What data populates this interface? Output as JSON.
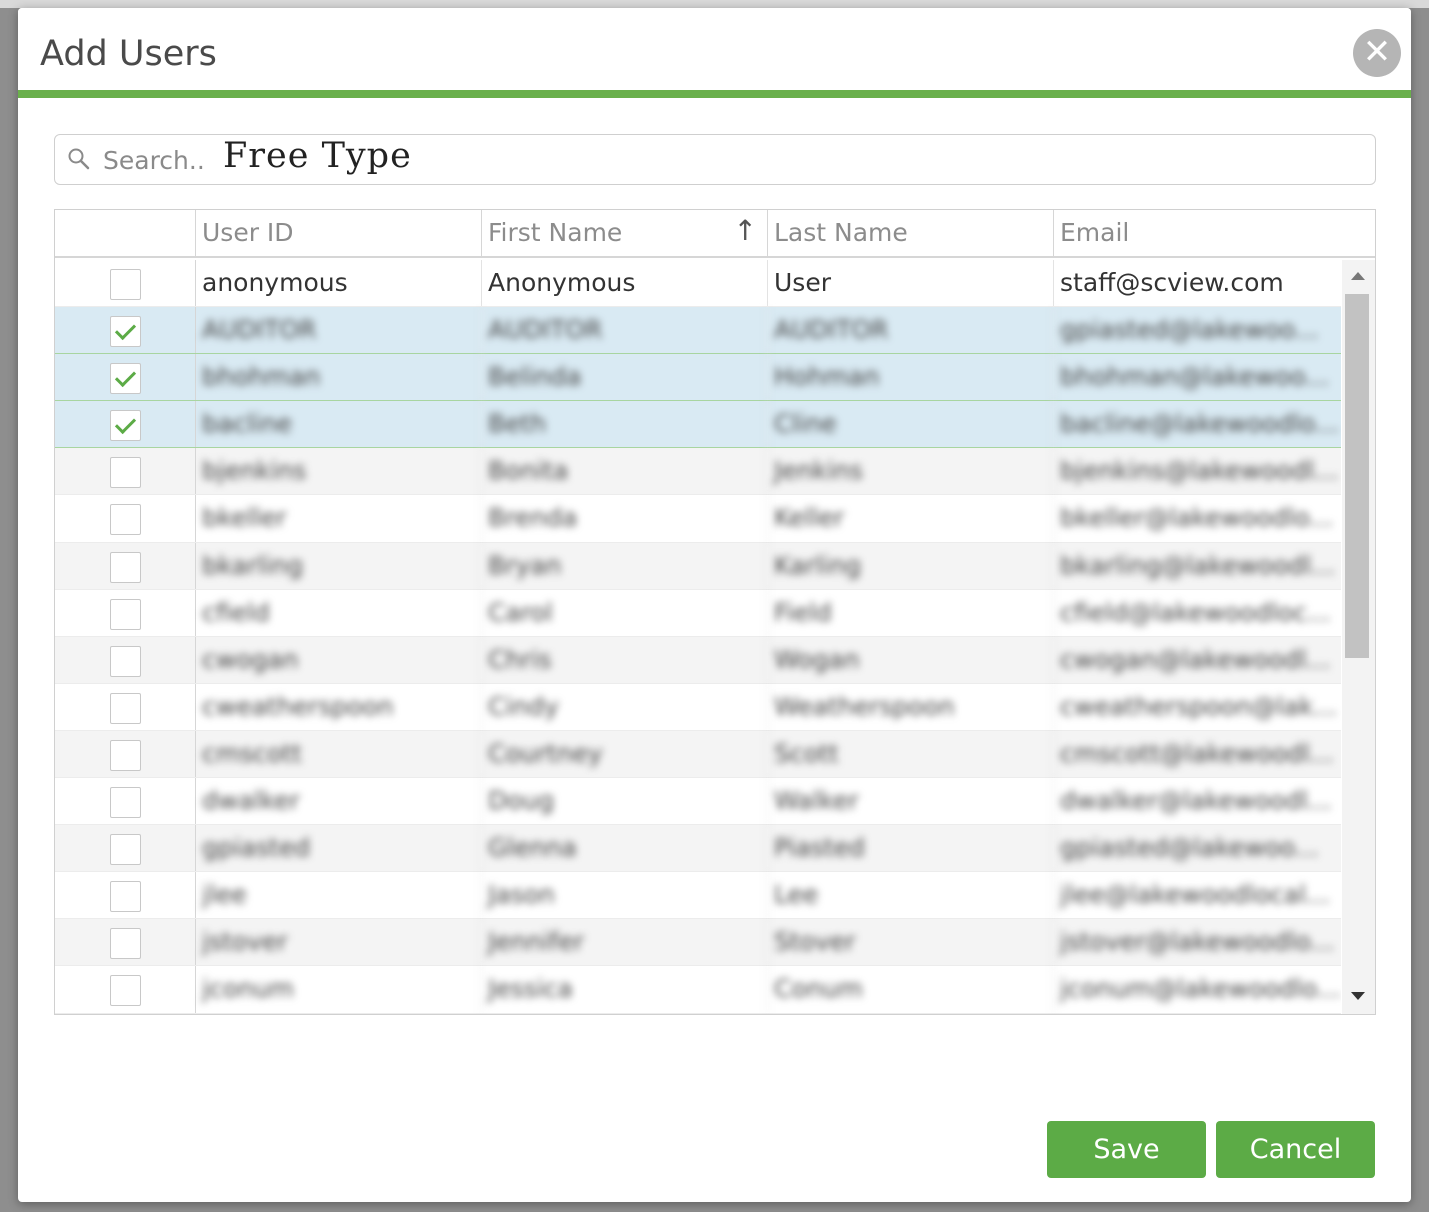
{
  "dialog": {
    "title": "Add Users",
    "close_label": "✕"
  },
  "search": {
    "placeholder": "Search..",
    "value": "Free Type"
  },
  "table": {
    "columns": [
      "User ID",
      "First Name",
      "Last Name",
      "Email"
    ],
    "sorted_column": "First Name",
    "sort_direction": "ascending",
    "rows": [
      {
        "user_id": "anonymous",
        "first_name": "Anonymous",
        "last_name": "User",
        "email": "staff@scview.com",
        "checked": false,
        "blurred": false
      },
      {
        "user_id": "AUDITOR",
        "first_name": "AUDITOR",
        "last_name": "AUDITOR",
        "email": "gpiasted@lakewoo...",
        "checked": true,
        "blurred": true
      },
      {
        "user_id": "bhohman",
        "first_name": "Belinda",
        "last_name": "Hohman",
        "email": "bhohman@lakewoo...",
        "checked": true,
        "blurred": true
      },
      {
        "user_id": "bacline",
        "first_name": "Beth",
        "last_name": "Cline",
        "email": "bacline@lakewoodlo...",
        "checked": true,
        "blurred": true
      },
      {
        "user_id": "bjenkins",
        "first_name": "Bonita",
        "last_name": "Jenkins",
        "email": "bjenkins@lakewoodl...",
        "checked": false,
        "blurred": true
      },
      {
        "user_id": "bkeller",
        "first_name": "Brenda",
        "last_name": "Keller",
        "email": "bkeller@lakewoodlo...",
        "checked": false,
        "blurred": true
      },
      {
        "user_id": "bkarling",
        "first_name": "Bryan",
        "last_name": "Karling",
        "email": "bkarling@lakewoodl...",
        "checked": false,
        "blurred": true
      },
      {
        "user_id": "cfield",
        "first_name": "Carol",
        "last_name": "Field",
        "email": "cfield@lakewoodloc...",
        "checked": false,
        "blurred": true
      },
      {
        "user_id": "cwogan",
        "first_name": "Chris",
        "last_name": "Wogan",
        "email": "cwogan@lakewoodl...",
        "checked": false,
        "blurred": true
      },
      {
        "user_id": "cweatherspoon",
        "first_name": "Cindy",
        "last_name": "Weatherspoon",
        "email": "cweatherspoon@lak...",
        "checked": false,
        "blurred": true
      },
      {
        "user_id": "cmscott",
        "first_name": "Courtney",
        "last_name": "Scott",
        "email": "cmscott@lakewoodl...",
        "checked": false,
        "blurred": true
      },
      {
        "user_id": "dwalker",
        "first_name": "Doug",
        "last_name": "Walker",
        "email": "dwalker@lakewoodl...",
        "checked": false,
        "blurred": true
      },
      {
        "user_id": "gpiasted",
        "first_name": "Glenna",
        "last_name": "Piasted",
        "email": "gpiasted@lakewoo...",
        "checked": false,
        "blurred": true
      },
      {
        "user_id": "jlee",
        "first_name": "Jason",
        "last_name": "Lee",
        "email": "jlee@lakewoodlocal...",
        "checked": false,
        "blurred": true
      },
      {
        "user_id": "jstover",
        "first_name": "Jennifer",
        "last_name": "Stover",
        "email": "jstover@lakewoodlo...",
        "checked": false,
        "blurred": true
      },
      {
        "user_id": "jconum",
        "first_name": "Jessica",
        "last_name": "Conum",
        "email": "jconum@lakewoodlo...",
        "checked": false,
        "blurred": true
      }
    ]
  },
  "buttons": {
    "save": "Save",
    "cancel": "Cancel"
  },
  "colors": {
    "accent": "#6ab04c",
    "button": "#5cab46",
    "selected_row": "#d9eaf3"
  }
}
